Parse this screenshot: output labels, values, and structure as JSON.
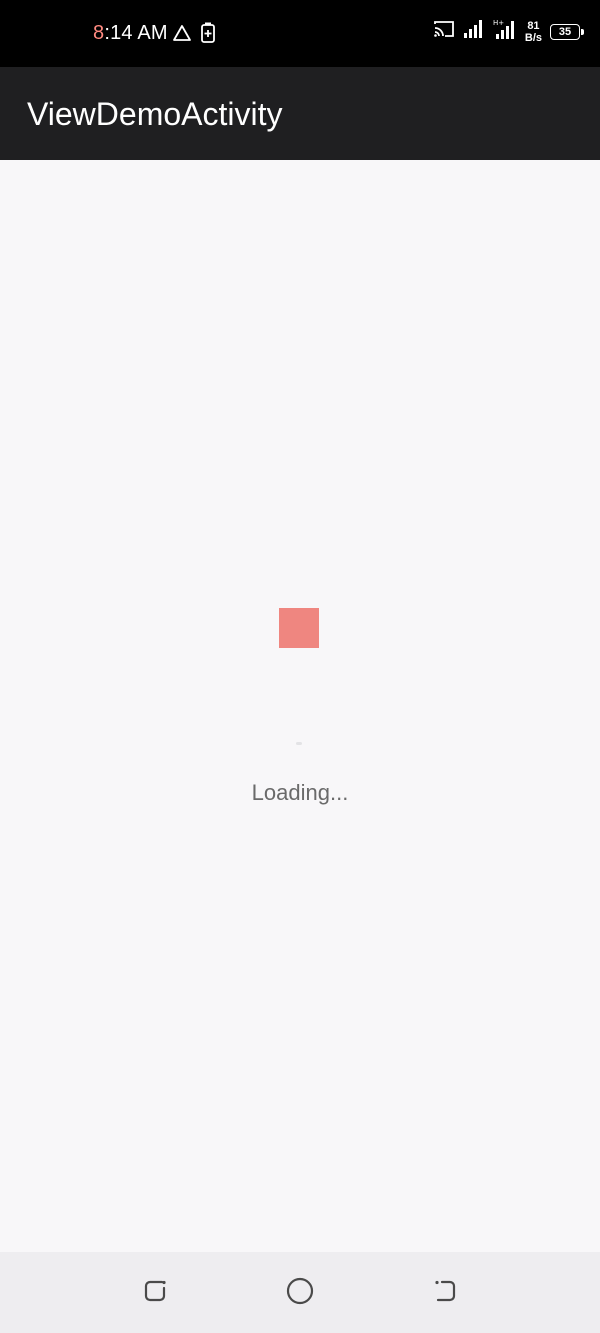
{
  "status_bar": {
    "time_hour": "8",
    "time_rest": ":14 AM",
    "net_speed_value": "81",
    "net_speed_unit": "B/s",
    "battery_level": "35",
    "icons": [
      "cast-icon",
      "signal-icon",
      "signal-icon-2",
      "warning-icon",
      "battery-saver-icon"
    ]
  },
  "app_bar": {
    "title": "ViewDemoActivity"
  },
  "content": {
    "loading_text": "Loading..."
  },
  "nav_bar": {
    "buttons": [
      "recent-apps-button",
      "home-button",
      "back-button"
    ]
  },
  "colors": {
    "status_bar_bg": "#000000",
    "app_bar_bg": "#1f1f21",
    "content_bg": "#f8f7f9",
    "loader_square": "#ef8680",
    "nav_bar_bg": "#eeedf0"
  }
}
